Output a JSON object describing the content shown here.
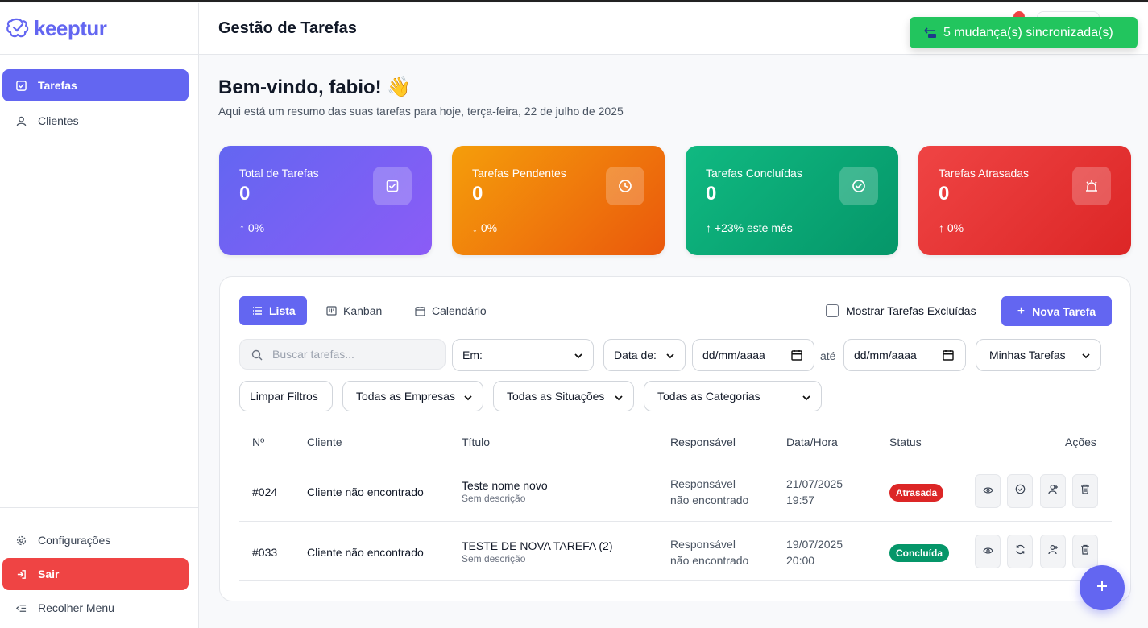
{
  "app": {
    "brand": "keeptur",
    "header_title": "Gestão de Tarefas"
  },
  "toast": {
    "text": "5 mudança(s) sincronizada(s)"
  },
  "sidebar": {
    "items": [
      {
        "label": "Tarefas",
        "icon": "check-square-icon",
        "active": true
      },
      {
        "label": "Clientes",
        "icon": "user-icon",
        "active": false
      }
    ],
    "bottom": [
      {
        "label": "Configurações",
        "icon": "gear-icon"
      },
      {
        "label": "Sair",
        "icon": "logout-icon"
      },
      {
        "label": "Recolher Menu",
        "icon": "collapse-menu-icon"
      }
    ]
  },
  "welcome": {
    "title": "Bem-vindo, fabio! 👋",
    "subtitle": "Aqui está um resumo das suas tarefas para hoje, terça-feira, 22 de julho de 2025"
  },
  "stats": [
    {
      "label": "Total de Tarefas",
      "value": "0",
      "trend": "↑ 0%",
      "icon": "check-square-icon",
      "color": "#6366f1"
    },
    {
      "label": "Tarefas Pendentes",
      "value": "0",
      "trend": "↓ 0%",
      "icon": "clock-icon",
      "color": "#f59e0b"
    },
    {
      "label": "Tarefas Concluídas",
      "value": "0",
      "trend": "↑ +23% este mês",
      "icon": "check-circle-icon",
      "color": "#10b981"
    },
    {
      "label": "Tarefas Atrasadas",
      "value": "0",
      "trend": "↑ 0%",
      "icon": "alarm-icon",
      "color": "#ef4444"
    }
  ],
  "views": {
    "list": "Lista",
    "kanban": "Kanban",
    "calendar": "Calendário",
    "active": "Lista"
  },
  "show_deleted_label": "Mostrar Tarefas Excluídas",
  "new_task_label": "Nova Tarefa",
  "filters": {
    "search_placeholder": "Buscar tarefas...",
    "em": "Em:",
    "date_type": "Data de:",
    "date_from": "dd/mm/aaaa",
    "until": "até",
    "date_to": "dd/mm/aaaa",
    "owner": "Minhas Tarefas",
    "clear": "Limpar Filtros",
    "companies": "Todas as Empresas",
    "situations": "Todas as Situações",
    "categories": "Todas as Categorias"
  },
  "table": {
    "headers": {
      "num": "Nº",
      "client": "Cliente",
      "title": "Título",
      "owner": "Responsável",
      "datetime": "Data/Hora",
      "status": "Status",
      "actions": "Ações"
    },
    "rows": [
      {
        "num": "#024",
        "client": "Cliente não encontrado",
        "title": "Teste nome novo",
        "desc": "Sem descrição",
        "owner1": "Responsável",
        "owner2": "não encontrado",
        "date": "21/07/2025",
        "time": "19:57",
        "status": "Atrasada",
        "status_color": "#dc2626"
      },
      {
        "num": "#033",
        "client": "Cliente não encontrado",
        "title": "TESTE DE NOVA TAREFA (2)",
        "desc": "Sem descrição",
        "owner1": "Responsável",
        "owner2": "não encontrado",
        "date": "19/07/2025",
        "time": "20:00",
        "status": "Concluída",
        "status_color": "#059669"
      }
    ]
  },
  "colors": {
    "accent": "#6366f1",
    "danger": "#ef4444",
    "success": "#22c55e"
  }
}
